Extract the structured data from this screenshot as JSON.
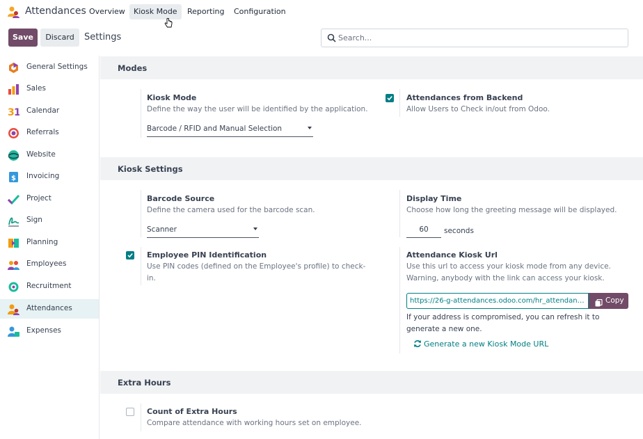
{
  "topnav": {
    "app_name": "Attendances",
    "menu": [
      {
        "label": "Overview",
        "active": false
      },
      {
        "label": "Kiosk Mode",
        "active": true
      },
      {
        "label": "Reporting",
        "active": false
      },
      {
        "label": "Configuration",
        "active": false
      }
    ]
  },
  "control_panel": {
    "save_label": "Save",
    "discard_label": "Discard",
    "breadcrumb": "Settings",
    "search_placeholder": "Search..."
  },
  "sidebar": {
    "items": [
      {
        "label": "General Settings",
        "icon": "general-settings-icon",
        "active": false
      },
      {
        "label": "Sales",
        "icon": "sales-icon",
        "active": false
      },
      {
        "label": "Calendar",
        "icon": "calendar-icon",
        "active": false
      },
      {
        "label": "Referrals",
        "icon": "referrals-icon",
        "active": false
      },
      {
        "label": "Website",
        "icon": "website-icon",
        "active": false
      },
      {
        "label": "Invoicing",
        "icon": "invoicing-icon",
        "active": false
      },
      {
        "label": "Project",
        "icon": "project-icon",
        "active": false
      },
      {
        "label": "Sign",
        "icon": "sign-icon",
        "active": false
      },
      {
        "label": "Planning",
        "icon": "planning-icon",
        "active": false
      },
      {
        "label": "Employees",
        "icon": "employees-icon",
        "active": false
      },
      {
        "label": "Recruitment",
        "icon": "recruitment-icon",
        "active": false
      },
      {
        "label": "Attendances",
        "icon": "attendances-icon",
        "active": true
      },
      {
        "label": "Expenses",
        "icon": "expenses-icon",
        "active": false
      }
    ]
  },
  "sections": {
    "modes": {
      "title": "Modes",
      "kiosk_mode": {
        "title": "Kiosk Mode",
        "description": "Define the way the user will be identified by the application.",
        "value": "Barcode / RFID and Manual Selection"
      },
      "attendances_backend": {
        "title": "Attendances from Backend",
        "description": "Allow Users to Check in/out from Odoo.",
        "checked": true
      }
    },
    "kiosk_settings": {
      "title": "Kiosk Settings",
      "barcode_source": {
        "title": "Barcode Source",
        "description": "Define the camera used for the barcode scan.",
        "value": "Scanner"
      },
      "display_time": {
        "title": "Display Time",
        "description": "Choose how long the greeting message will be displayed.",
        "value": "60",
        "unit": "seconds"
      },
      "pin_identification": {
        "title": "Employee PIN Identification",
        "description": "Use PIN codes (defined on the Employee's profile) to check-in.",
        "checked": true
      },
      "kiosk_url": {
        "title": "Attendance Kiosk Url",
        "description": "Use this url to access your kiosk mode from any device. Warning, anybody with the link can access your kiosk.",
        "url": "https://26-g-attendances.odoo.com/hr_attendance/...",
        "copy_label": "Copy",
        "note": "If your address is compromised, you can refresh it to generate a new one.",
        "generate_label": "Generate a new Kiosk Mode URL"
      }
    },
    "extra_hours": {
      "title": "Extra Hours",
      "count_extra_hours": {
        "title": "Count of Extra Hours",
        "description": "Compare attendance with working hours set on employee.",
        "checked": false
      }
    }
  },
  "colors": {
    "brand": "#714b67",
    "accent": "#017e84",
    "section_bg": "#f1f2f4"
  }
}
